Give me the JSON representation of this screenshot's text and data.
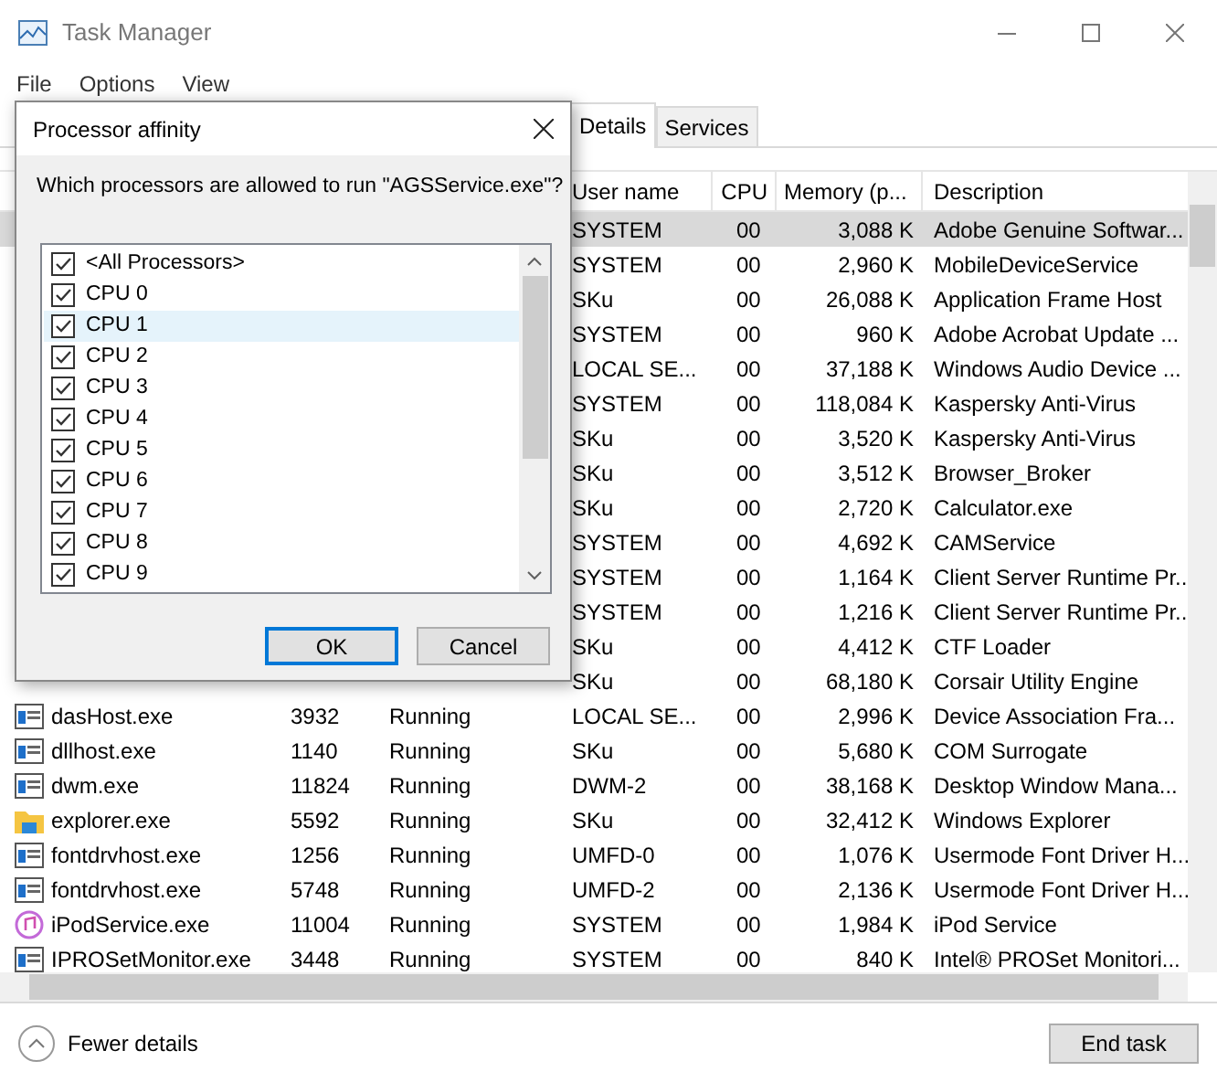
{
  "window": {
    "title": "Task Manager"
  },
  "menu": [
    "File",
    "Options",
    "View"
  ],
  "tabs": [
    {
      "label": "Details",
      "selected": true
    },
    {
      "label": "Services",
      "selected": false
    }
  ],
  "columns": [
    "User name",
    "CPU",
    "Memory (p...",
    "Description"
  ],
  "rows": [
    {
      "user": "SYSTEM",
      "cpu": "00",
      "memory": "3,088 K",
      "description": "Adobe Genuine Softwar...",
      "selected": true
    },
    {
      "user": "SYSTEM",
      "cpu": "00",
      "memory": "2,960 K",
      "description": "MobileDeviceService",
      "selected": false
    },
    {
      "user": "SKu",
      "cpu": "00",
      "memory": "26,088 K",
      "description": "Application Frame Host",
      "selected": false
    },
    {
      "user": "SYSTEM",
      "cpu": "00",
      "memory": "960 K",
      "description": "Adobe Acrobat Update ...",
      "selected": false
    },
    {
      "user": "LOCAL SE...",
      "cpu": "00",
      "memory": "37,188 K",
      "description": "Windows Audio Device ...",
      "selected": false
    },
    {
      "user": "SYSTEM",
      "cpu": "00",
      "memory": "118,084 K",
      "description": "Kaspersky Anti-Virus",
      "selected": false
    },
    {
      "user": "SKu",
      "cpu": "00",
      "memory": "3,520 K",
      "description": "Kaspersky Anti-Virus",
      "selected": false
    },
    {
      "user": "SKu",
      "cpu": "00",
      "memory": "3,512 K",
      "description": "Browser_Broker",
      "selected": false
    },
    {
      "user": "SKu",
      "cpu": "00",
      "memory": "2,720 K",
      "description": "Calculator.exe",
      "selected": false
    },
    {
      "user": "SYSTEM",
      "cpu": "00",
      "memory": "4,692 K",
      "description": "CAMService",
      "selected": false
    },
    {
      "user": "SYSTEM",
      "cpu": "00",
      "memory": "1,164 K",
      "description": "Client Server Runtime Pr...",
      "selected": false
    },
    {
      "user": "SYSTEM",
      "cpu": "00",
      "memory": "1,216 K",
      "description": "Client Server Runtime Pr...",
      "selected": false
    },
    {
      "user": "SKu",
      "cpu": "00",
      "memory": "4,412 K",
      "description": "CTF Loader",
      "selected": false
    },
    {
      "user": "SKu",
      "cpu": "00",
      "memory": "68,180 K",
      "description": "Corsair Utility Engine",
      "selected": false
    },
    {
      "kind": "app",
      "name": "dasHost.exe",
      "pid": "3932",
      "status": "Running",
      "user": "LOCAL SE...",
      "cpu": "00",
      "memory": "2,996 K",
      "description": "Device Association Fra...",
      "selected": false
    },
    {
      "kind": "app",
      "name": "dllhost.exe",
      "pid": "1140",
      "status": "Running",
      "user": "SKu",
      "cpu": "00",
      "memory": "5,680 K",
      "description": "COM Surrogate",
      "selected": false
    },
    {
      "kind": "app",
      "name": "dwm.exe",
      "pid": "11824",
      "status": "Running",
      "user": "DWM-2",
      "cpu": "00",
      "memory": "38,168 K",
      "description": "Desktop Window Mana...",
      "selected": false
    },
    {
      "kind": "folder",
      "name": "explorer.exe",
      "pid": "5592",
      "status": "Running",
      "user": "SKu",
      "cpu": "00",
      "memory": "32,412 K",
      "description": "Windows Explorer",
      "selected": false
    },
    {
      "kind": "app",
      "name": "fontdrvhost.exe",
      "pid": "1256",
      "status": "Running",
      "user": "UMFD-0",
      "cpu": "00",
      "memory": "1,076 K",
      "description": "Usermode Font Driver H...",
      "selected": false
    },
    {
      "kind": "app",
      "name": "fontdrvhost.exe",
      "pid": "5748",
      "status": "Running",
      "user": "UMFD-2",
      "cpu": "00",
      "memory": "2,136 K",
      "description": "Usermode Font Driver H...",
      "selected": false
    },
    {
      "kind": "music",
      "name": "iPodService.exe",
      "pid": "11004",
      "status": "Running",
      "user": "SYSTEM",
      "cpu": "00",
      "memory": "1,984 K",
      "description": "iPod Service",
      "selected": false
    },
    {
      "kind": "app",
      "name": "IPROSetMonitor.exe",
      "pid": "3448",
      "status": "Running",
      "user": "SYSTEM",
      "cpu": "00",
      "memory": "840 K",
      "description": "Intel® PROSet Monitori...",
      "selected": false
    }
  ],
  "footer": {
    "fewer_details": "Fewer details",
    "end_task": "End task"
  },
  "dialog": {
    "title": "Processor affinity",
    "question": "Which processors are allowed to run \"AGSService.exe\"?",
    "items": [
      {
        "label": "<All Processors>",
        "checked": true,
        "selected": false
      },
      {
        "label": "CPU 0",
        "checked": true,
        "selected": false
      },
      {
        "label": "CPU 1",
        "checked": true,
        "selected": true
      },
      {
        "label": "CPU 2",
        "checked": true,
        "selected": false
      },
      {
        "label": "CPU 3",
        "checked": true,
        "selected": false
      },
      {
        "label": "CPU 4",
        "checked": true,
        "selected": false
      },
      {
        "label": "CPU 5",
        "checked": true,
        "selected": false
      },
      {
        "label": "CPU 6",
        "checked": true,
        "selected": false
      },
      {
        "label": "CPU 7",
        "checked": true,
        "selected": false
      },
      {
        "label": "CPU 8",
        "checked": true,
        "selected": false
      },
      {
        "label": "CPU 9",
        "checked": true,
        "selected": false
      }
    ],
    "ok": "OK",
    "cancel": "Cancel"
  }
}
